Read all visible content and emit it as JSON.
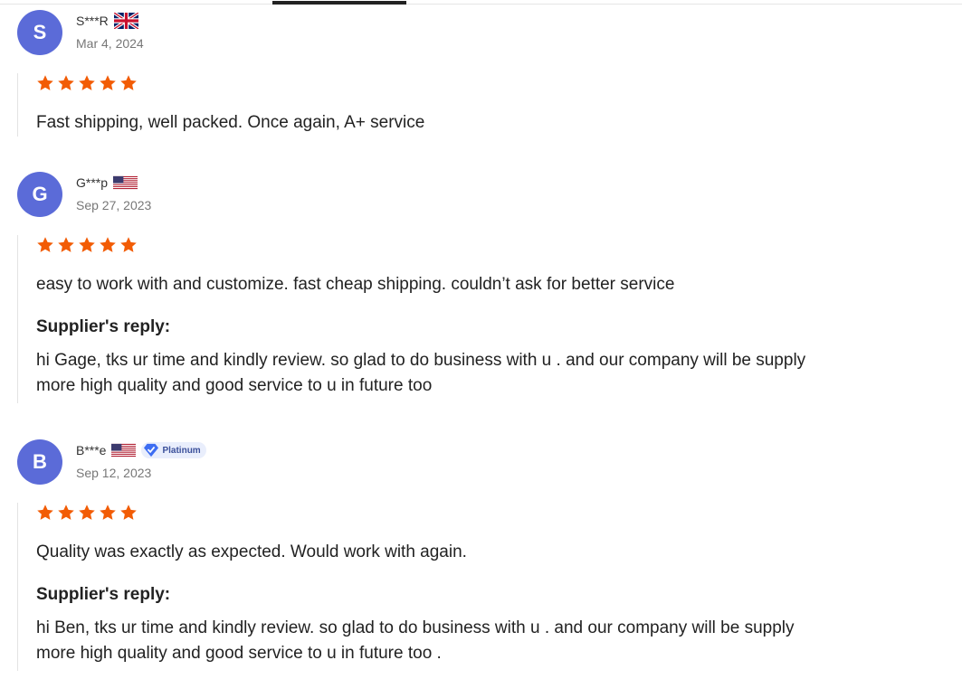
{
  "reviews": [
    {
      "initial": "S",
      "name": "S***R",
      "flag": "uk-flag-icon",
      "date": "Mar 4, 2024",
      "rating": 5,
      "text": "Fast shipping, well packed. Once again, A+ service"
    },
    {
      "initial": "G",
      "name": "G***p",
      "flag": "us-flag-icon",
      "date": "Sep 27, 2023",
      "rating": 5,
      "text": "easy to work with and customize. fast cheap shipping. couldn’t ask for better service",
      "reply_label": "Supplier's reply:",
      "reply_lines": [
        "hi Gage, tks ur time and kindly review. so glad to do business with u . and our company will be supply",
        "more high quality and good service to u in future too"
      ]
    },
    {
      "initial": "B",
      "name": "B***e",
      "flag": "us-flag-icon",
      "badge": "Platinum",
      "date": "Sep 12, 2023",
      "rating": 5,
      "text": "Quality was exactly as expected. Would work with again.",
      "reply_label": "Supplier's reply:",
      "reply_lines": [
        "hi Ben, tks ur time and kindly review. so glad to do business with u . and our company will be supply",
        "more high quality and good service to u in future too ."
      ]
    }
  ],
  "colors": {
    "avatar": "#5b6bd8",
    "star": "#f25c05",
    "badge_bg": "#e9eefc",
    "badge_icon": "#3d6df2"
  }
}
